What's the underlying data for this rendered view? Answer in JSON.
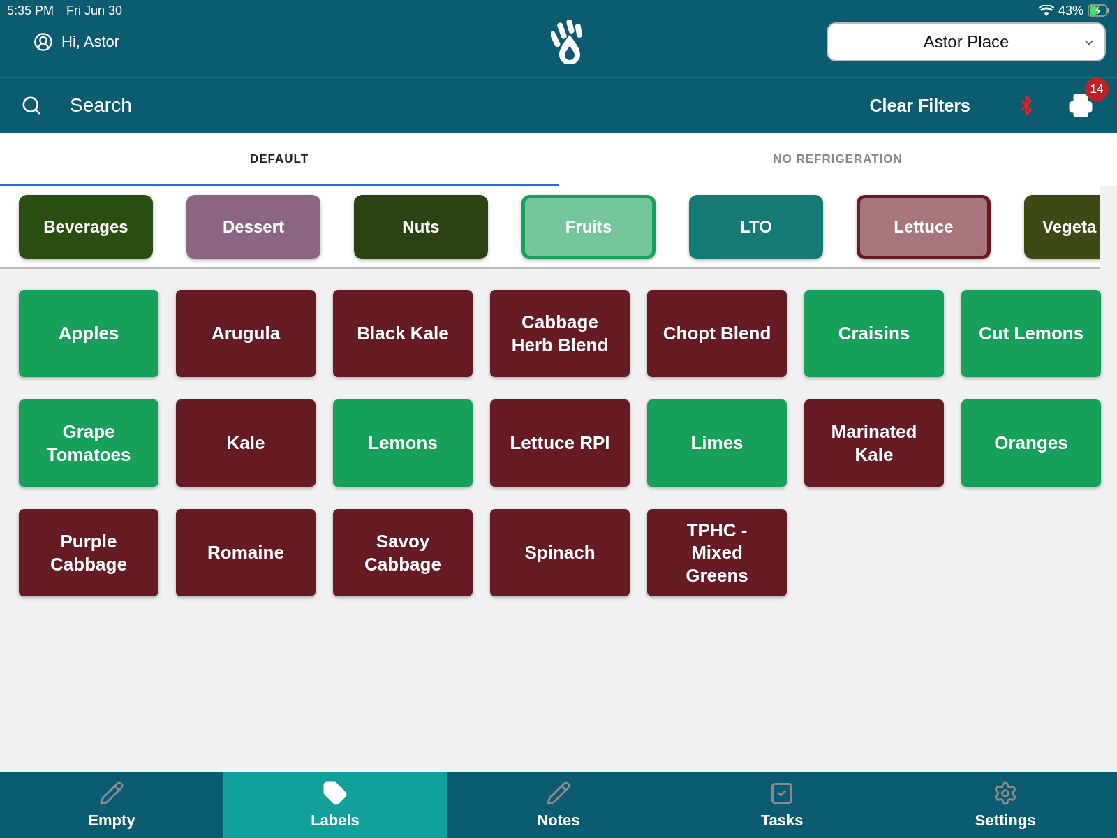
{
  "status_bar": {
    "time": "5:35 PM",
    "date": "Fri Jun 30",
    "battery": "43%"
  },
  "header": {
    "greeting": "Hi, Astor",
    "location": "Astor Place"
  },
  "toolbar": {
    "search": {
      "placeholder": "Search"
    },
    "clear_filters": "Clear Filters",
    "printer_badge": "14"
  },
  "tabs": [
    {
      "label": "DEFAULT",
      "selected": true
    },
    {
      "label": "NO REFRIGERATION",
      "selected": false
    }
  ],
  "categories": [
    {
      "label": "Beverages",
      "color": "#2a4d11",
      "selected": false
    },
    {
      "label": "Dessert",
      "color": "#8a6680",
      "selected": false
    },
    {
      "label": "Nuts",
      "color": "#2b4313",
      "selected": false
    },
    {
      "label": "Fruits",
      "color": "#16a05a",
      "selected": true
    },
    {
      "label": "LTO",
      "color": "#157a73",
      "selected": false
    },
    {
      "label": "Lettuce",
      "color": "#6b1a24",
      "selected": true
    },
    {
      "label": "Vegeta",
      "color": "#3e4a16",
      "selected": false
    }
  ],
  "items": [
    {
      "label": "Apples",
      "color": "#16a05a"
    },
    {
      "label": "Arugula",
      "color": "#661a22"
    },
    {
      "label": "Black Kale",
      "color": "#661a22"
    },
    {
      "label": "Cabbage Herb Blend",
      "color": "#661a22"
    },
    {
      "label": "Chopt Blend",
      "color": "#661a22"
    },
    {
      "label": "Craisins",
      "color": "#16a05a"
    },
    {
      "label": "Cut Lemons",
      "color": "#16a05a"
    },
    {
      "label": "Grape Tomatoes",
      "color": "#16a05a"
    },
    {
      "label": "Kale",
      "color": "#661a22"
    },
    {
      "label": "Lemons",
      "color": "#16a05a"
    },
    {
      "label": "Lettuce RPI",
      "color": "#661a22"
    },
    {
      "label": "Limes",
      "color": "#16a05a"
    },
    {
      "label": "Marinated Kale",
      "color": "#661a22"
    },
    {
      "label": "Oranges",
      "color": "#16a05a"
    },
    {
      "label": "Purple Cabbage",
      "color": "#661a22"
    },
    {
      "label": "Romaine",
      "color": "#661a22"
    },
    {
      "label": "Savoy Cabbage",
      "color": "#661a22"
    },
    {
      "label": "Spinach",
      "color": "#661a22"
    },
    {
      "label": "TPHC - Mixed Greens",
      "color": "#661a22"
    }
  ],
  "nav": [
    {
      "label": "Empty",
      "kind": "pencil",
      "selected": false
    },
    {
      "label": "Labels",
      "kind": "tag",
      "selected": true
    },
    {
      "label": "Notes",
      "kind": "pencil",
      "selected": false
    },
    {
      "label": "Tasks",
      "kind": "check",
      "selected": false
    },
    {
      "label": "Settings",
      "kind": "gear",
      "selected": false
    }
  ]
}
